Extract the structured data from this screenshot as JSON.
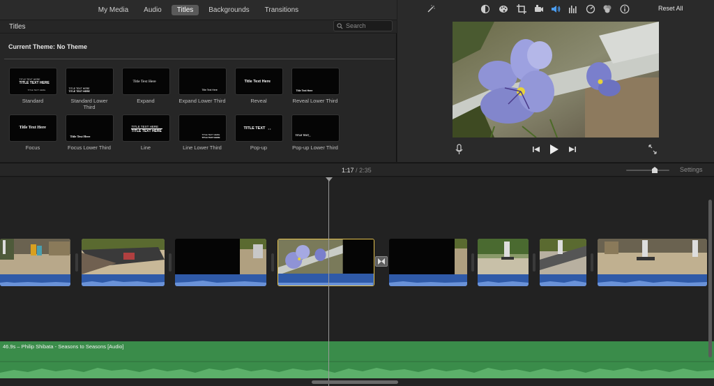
{
  "browser": {
    "tabs": [
      {
        "label": "My Media"
      },
      {
        "label": "Audio"
      },
      {
        "label": "Titles",
        "active": true
      },
      {
        "label": "Backgrounds"
      },
      {
        "label": "Transitions"
      }
    ],
    "section_title": "Titles",
    "search_placeholder": "Search",
    "current_theme": "Current Theme: No Theme",
    "titles": [
      {
        "name": "Standard"
      },
      {
        "name": "Standard Lower Third"
      },
      {
        "name": "Expand"
      },
      {
        "name": "Expand Lower Third"
      },
      {
        "name": "Reveal"
      },
      {
        "name": "Reveal Lower Third"
      },
      {
        "name": "Focus"
      },
      {
        "name": "Focus Lower Third"
      },
      {
        "name": "Line"
      },
      {
        "name": "Line Lower Third"
      },
      {
        "name": "Pop-up"
      },
      {
        "name": "Pop-up Lower Third"
      }
    ],
    "thumb_text": {
      "upper_caps": "TITLE TEXT HERE",
      "title_case": "Title Text Here",
      "popup": "TITLE TEXT",
      "popup_dots": "• •"
    }
  },
  "viewer": {
    "tools": [
      "magic-wand-icon",
      "color-balance-icon",
      "color-palette-icon",
      "crop-icon",
      "stabilization-icon",
      "volume-icon",
      "equalizer-icon",
      "speed-icon",
      "filter-icon",
      "info-icon"
    ],
    "reset_label": "Reset All",
    "colors": {
      "active_tool": "#4a9cf0"
    }
  },
  "timeline": {
    "current_time": "1:17",
    "separator": "/",
    "total_time": "2:35",
    "settings_label": "Settings",
    "music_label": "46.9s – Philip Shibata - Seasons to Seasons [Audio]",
    "colors": {
      "audio_track": "#2f5aa8",
      "music_track": "#3a8c4a",
      "selection": "#e8c550"
    }
  }
}
